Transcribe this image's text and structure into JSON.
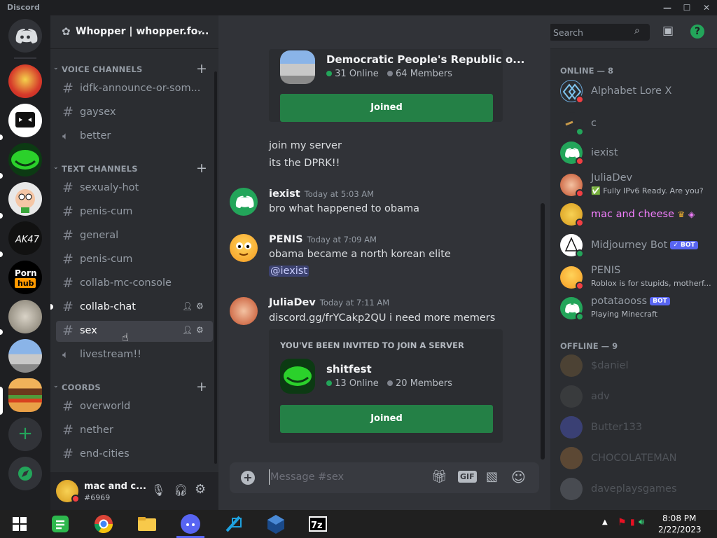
{
  "window": {
    "title": "Discord"
  },
  "server": {
    "name": "Whopper | whopper.fo..."
  },
  "channel_header": {
    "name": "sex",
    "search_placeholder": "Search"
  },
  "categories": {
    "voice": "VOICE CHANNELS",
    "text": "TEXT CHANNELS",
    "coords": "COORDS"
  },
  "channels": {
    "voice": [
      "idfk-announce-or-som...",
      "gaysex",
      "better"
    ],
    "text": [
      "sexualy-hot",
      "penis-cum",
      "general",
      "penis-cum",
      "collab-mc-console",
      "collab-chat",
      "sex",
      "livestream!!"
    ],
    "coords": [
      "overworld",
      "nether",
      "end-cities"
    ]
  },
  "user": {
    "name": "mac and c...",
    "tag": "#6969"
  },
  "invite1": {
    "server": "Democratic People's Republic o...",
    "online": "31 Online",
    "members": "64 Members",
    "button": "Joined"
  },
  "messages": [
    {
      "text": "join my server"
    },
    {
      "text": "its the DPRK!!"
    },
    {
      "author": "iexist",
      "time": "Today at 5:03 AM",
      "text": "bro what happened to obama"
    },
    {
      "author": "PENIS",
      "time": "Today at 7:09 AM",
      "text": "obama became a north korean elite",
      "mention": "@iexist"
    },
    {
      "author": "JuliaDev",
      "time": "Today at 7:11 AM",
      "text": "discord.gg/frYCakp2QU i need more memers"
    }
  ],
  "invite2": {
    "heading": "YOU'VE BEEN INVITED TO JOIN A SERVER",
    "server": "shitfest",
    "online": "13 Online",
    "members": "20 Members",
    "button": "Joined"
  },
  "composer": {
    "placeholder": "Message #sex",
    "gif": "GIF"
  },
  "members": {
    "online_heading": "ONLINE — 8",
    "offline_heading": "OFFLINE — 9",
    "online": [
      {
        "name": "Alphabet Lore X",
        "status": ""
      },
      {
        "name": "c",
        "status": ""
      },
      {
        "name": "iexist",
        "status": ""
      },
      {
        "name": "JuliaDev",
        "status": "✅ Fully IPv6 Ready. Are you?"
      },
      {
        "name": "mac and cheese",
        "status": ""
      },
      {
        "name": "Midjourney Bot",
        "status": "",
        "badge": "✓ BOT"
      },
      {
        "name": "PENIS",
        "status": "Roblox is for stupids, motherf..."
      },
      {
        "name": "potataooss",
        "status": "Playing Minecraft",
        "badge": "BOT"
      }
    ],
    "offline": [
      "$daniel",
      "adv",
      "Butter133",
      "CHOCOLATEMAN",
      "daveplaysgames"
    ]
  },
  "taskbar": {
    "time": "8:08 PM",
    "date": "2/22/2023"
  },
  "colors": {
    "accent": "#5865f2",
    "green": "#248046",
    "online": "#23a55a",
    "dnd": "#f23f43"
  }
}
